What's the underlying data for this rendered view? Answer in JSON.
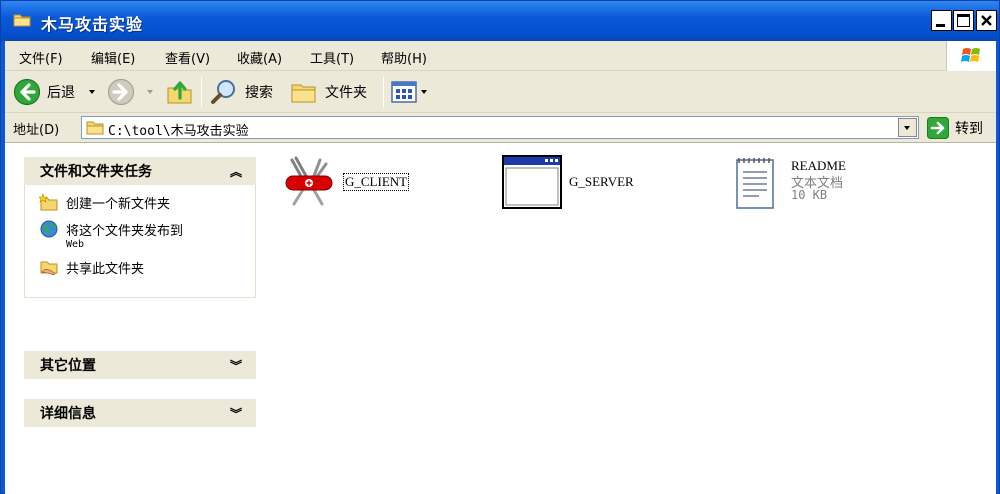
{
  "window": {
    "title": "木马攻击实验"
  },
  "menu": {
    "items": [
      "文件(F)",
      "编辑(E)",
      "查看(V)",
      "收藏(A)",
      "工具(T)",
      "帮助(H)"
    ]
  },
  "toolbar": {
    "back": "后退",
    "search": "搜索",
    "folders": "文件夹"
  },
  "address": {
    "label": "地址(D)",
    "path": "C:\\tool\\木马攻击实验",
    "go": "转到"
  },
  "tasks": {
    "title": "文件和文件夹任务",
    "items": [
      {
        "label": "创建一个新文件夹",
        "sub": ""
      },
      {
        "label": "将这个文件夹发布到",
        "sub": "Web"
      },
      {
        "label": "共享此文件夹",
        "sub": ""
      }
    ]
  },
  "other_places": {
    "title": "其它位置"
  },
  "details": {
    "title": "详细信息"
  },
  "files": [
    {
      "name": "G_CLIENT",
      "icon": "swiss-knife-icon"
    },
    {
      "name": "G_SERVER",
      "icon": "application-window-icon"
    },
    {
      "name": "README",
      "type": "文本文档",
      "size": "10 KB",
      "icon": "text-document-icon"
    }
  ],
  "colors": {
    "titlebar": "#0a5ad8",
    "chrome": "#ece9d8",
    "panel_head": "#ece9d8"
  }
}
